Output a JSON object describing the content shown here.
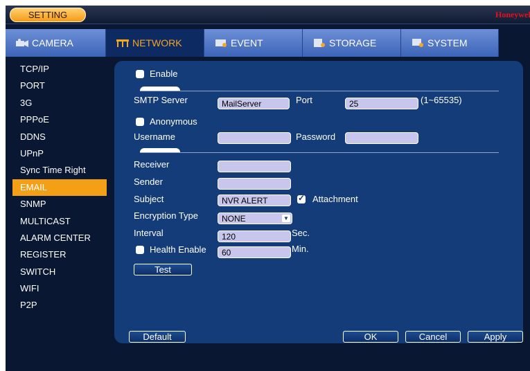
{
  "titlebar": {
    "setting_label": "SETTING",
    "brand": "Honeywell"
  },
  "tabs": [
    {
      "label": "CAMERA",
      "icon": "camera-icon"
    },
    {
      "label": "NETWORK",
      "icon": "network-icon",
      "active": true
    },
    {
      "label": "EVENT",
      "icon": "event-icon"
    },
    {
      "label": "STORAGE",
      "icon": "storage-icon"
    },
    {
      "label": "SYSTEM",
      "icon": "system-icon"
    }
  ],
  "sidebar": {
    "items": [
      "TCP/IP",
      "PORT",
      "3G",
      "PPPoE",
      "DDNS",
      "UPnP",
      "Sync Time Right",
      "EMAIL",
      "SNMP",
      "MULTICAST",
      "ALARM CENTER",
      "REGISTER",
      "SWITCH",
      "WIFI",
      "P2P"
    ],
    "active": "EMAIL"
  },
  "email": {
    "enable_label": "Enable",
    "smtp_label": "SMTP Server",
    "smtp_value": "MailServer",
    "port_label": "Port",
    "port_value": "25",
    "port_range": "(1~65535)",
    "anonymous_label": "Anonymous",
    "username_label": "Username",
    "username_value": "",
    "password_label": "Password",
    "password_value": "",
    "receiver_label": "Receiver",
    "receiver_value": "",
    "sender_label": "Sender",
    "sender_value": "",
    "subject_label": "Subject",
    "subject_value": "NVR ALERT",
    "attachment_label": "Attachment",
    "attachment_checked": true,
    "encryption_label": "Encryption Type",
    "encryption_value": "NONE",
    "interval_label": "Interval",
    "interval_value": "120",
    "interval_unit": "Sec.",
    "health_label": "Health Enable",
    "health_value": "60",
    "health_unit": "Min.",
    "test_label": "Test"
  },
  "footer": {
    "default_label": "Default",
    "ok_label": "OK",
    "cancel_label": "Cancel",
    "apply_label": "Apply"
  },
  "colors": {
    "background": "#0a1733",
    "panel": "#143c78",
    "accent": "#f3a017",
    "tab": "#5a7ccb",
    "brand": "#e8101e"
  }
}
